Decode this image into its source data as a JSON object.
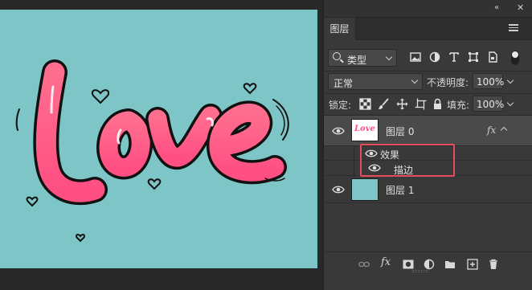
{
  "panel": {
    "collapse_glyph": "«",
    "close_glyph": "✕",
    "tab_label": "图层",
    "filter": {
      "selected": "类型"
    },
    "blend_mode": "正常",
    "opacity_label": "不透明度:",
    "opacity_value": "100%",
    "lock_label": "锁定:",
    "fill_label": "填充:",
    "fill_value": "100%"
  },
  "layers": [
    {
      "name": "图层 0",
      "fx_badge": "fx",
      "thumb_text": "Love",
      "effects_label": "效果",
      "effects": [
        {
          "label": "描边"
        }
      ]
    },
    {
      "name": "图层 1",
      "thumb_color": "#7ec5c7"
    }
  ],
  "bottom_icons": [
    "link-icon",
    "fx-icon",
    "mask-icon",
    "adjustment-icon",
    "folder-icon",
    "new-layer-icon",
    "trash-icon"
  ],
  "bottom_fx_label": "fx",
  "colors": {
    "canvas_bg": "#7ec5c7",
    "love_fill": "#ff5a87",
    "highlight": "#e64d5c"
  }
}
